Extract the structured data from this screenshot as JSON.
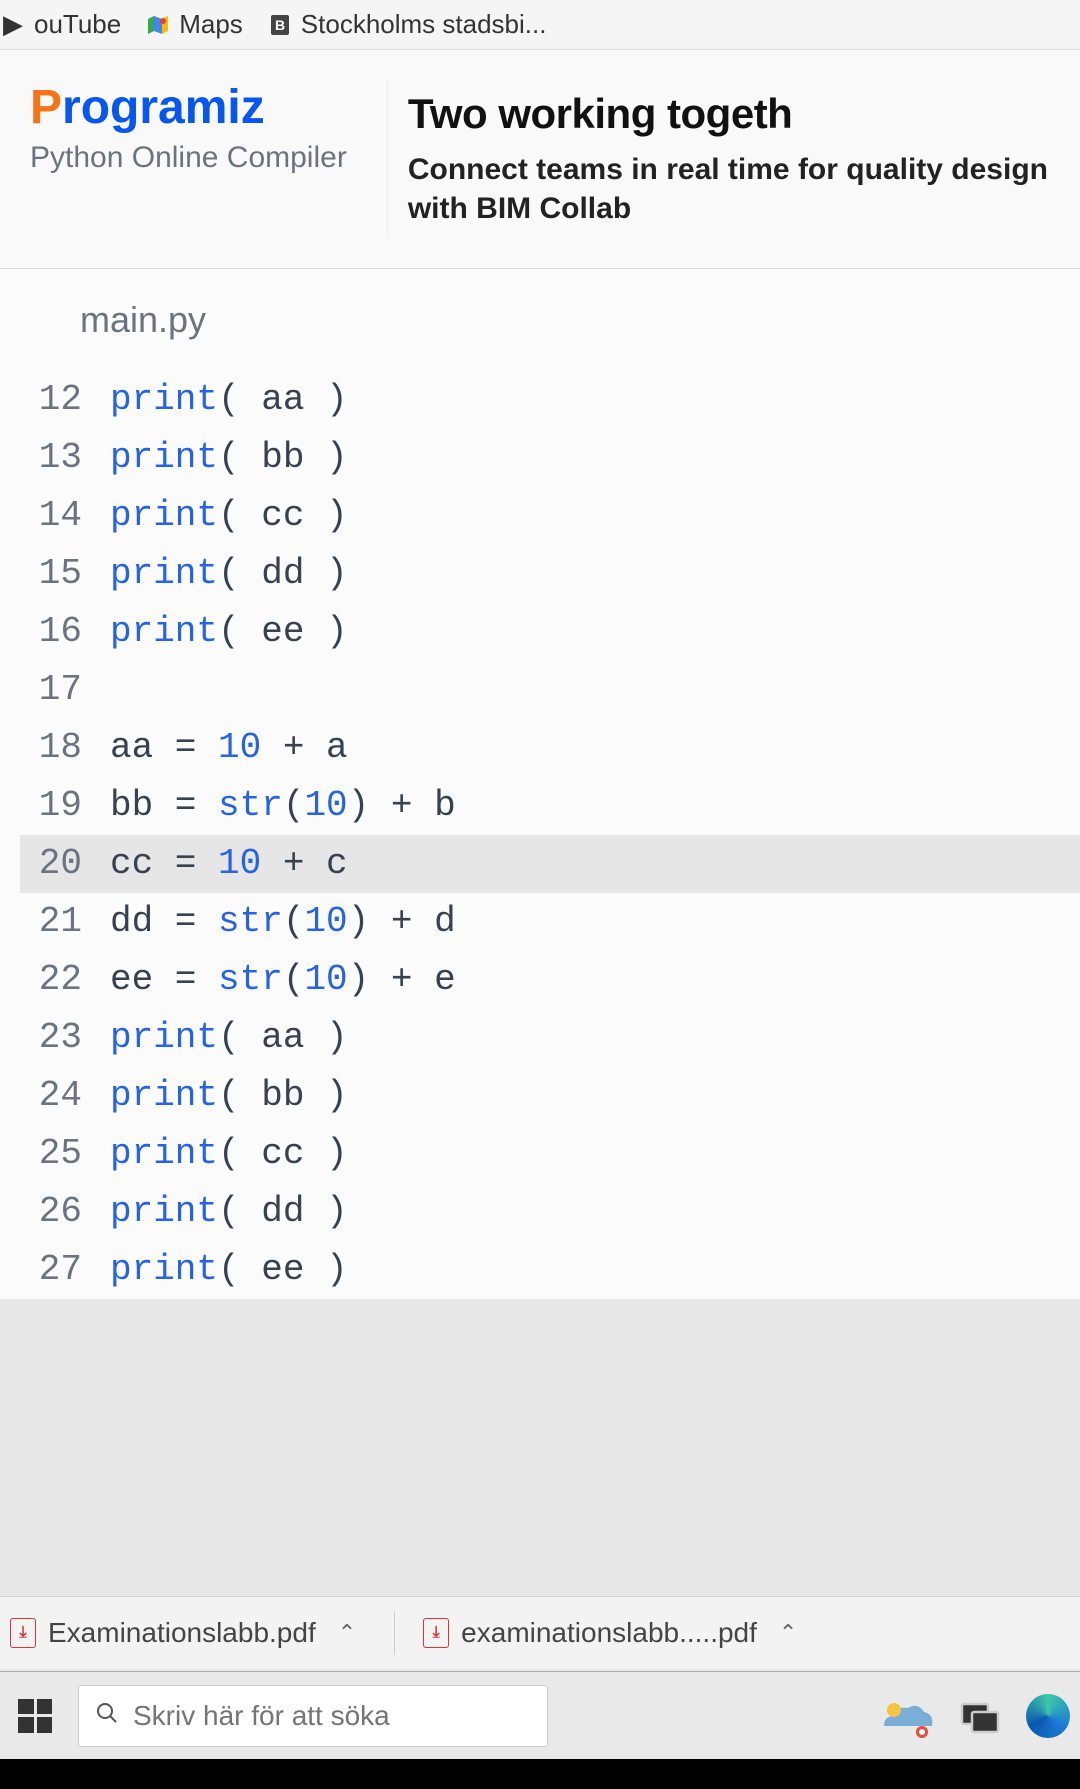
{
  "bookmarks": [
    {
      "label": "ouTube",
      "iconName": "youtube-icon"
    },
    {
      "label": "Maps",
      "iconName": "maps-icon"
    },
    {
      "label": "Stockholms stadsbi...",
      "iconName": "library-icon"
    }
  ],
  "brand": {
    "prefix_char": "P",
    "rest": "rogramiz",
    "subtitle": "Python Online Compiler"
  },
  "ad": {
    "title": "Two working togeth",
    "body": "Connect teams in real time for quality design with BIM Collab"
  },
  "editor": {
    "filename": "main.py",
    "highlighted_line": 20,
    "lines": [
      {
        "n": 12,
        "tokens": [
          [
            "fn",
            "print"
          ],
          [
            "plain",
            "( aa )"
          ]
        ]
      },
      {
        "n": 13,
        "tokens": [
          [
            "fn",
            "print"
          ],
          [
            "plain",
            "( bb )"
          ]
        ]
      },
      {
        "n": 14,
        "tokens": [
          [
            "fn",
            "print"
          ],
          [
            "plain",
            "( cc )"
          ]
        ]
      },
      {
        "n": 15,
        "tokens": [
          [
            "fn",
            "print"
          ],
          [
            "plain",
            "( dd )"
          ]
        ]
      },
      {
        "n": 16,
        "tokens": [
          [
            "fn",
            "print"
          ],
          [
            "plain",
            "( ee )"
          ]
        ]
      },
      {
        "n": 17,
        "tokens": []
      },
      {
        "n": 18,
        "tokens": [
          [
            "plain",
            "aa = "
          ],
          [
            "num",
            "10"
          ],
          [
            "plain",
            " + a"
          ]
        ]
      },
      {
        "n": 19,
        "tokens": [
          [
            "plain",
            "bb = "
          ],
          [
            "fn",
            "str"
          ],
          [
            "plain",
            "("
          ],
          [
            "num",
            "10"
          ],
          [
            "plain",
            ") + b"
          ]
        ]
      },
      {
        "n": 20,
        "tokens": [
          [
            "plain",
            "cc = "
          ],
          [
            "num",
            "10"
          ],
          [
            "plain",
            " + c"
          ]
        ]
      },
      {
        "n": 21,
        "tokens": [
          [
            "plain",
            "dd = "
          ],
          [
            "fn",
            "str"
          ],
          [
            "plain",
            "("
          ],
          [
            "num",
            "10"
          ],
          [
            "plain",
            ") + d"
          ]
        ]
      },
      {
        "n": 22,
        "tokens": [
          [
            "plain",
            "ee = "
          ],
          [
            "fn",
            "str"
          ],
          [
            "plain",
            "("
          ],
          [
            "num",
            "10"
          ],
          [
            "plain",
            ") + e"
          ]
        ]
      },
      {
        "n": 23,
        "tokens": [
          [
            "fn",
            "print"
          ],
          [
            "plain",
            "( aa )"
          ]
        ]
      },
      {
        "n": 24,
        "tokens": [
          [
            "fn",
            "print"
          ],
          [
            "plain",
            "( bb )"
          ]
        ]
      },
      {
        "n": 25,
        "tokens": [
          [
            "fn",
            "print"
          ],
          [
            "plain",
            "( cc )"
          ]
        ]
      },
      {
        "n": 26,
        "tokens": [
          [
            "fn",
            "print"
          ],
          [
            "plain",
            "( dd )"
          ]
        ]
      },
      {
        "n": 27,
        "tokens": [
          [
            "fn",
            "print"
          ],
          [
            "plain",
            "( ee )"
          ]
        ]
      }
    ]
  },
  "downloads": [
    {
      "name": "Examinationslabb.pdf"
    },
    {
      "name": "examinationslabb.....pdf"
    }
  ],
  "taskbar": {
    "search_placeholder": "Skriv här för att söka"
  },
  "glyphs": {
    "pdf": "⏷",
    "search": "⌕",
    "chevron": "⌃"
  }
}
